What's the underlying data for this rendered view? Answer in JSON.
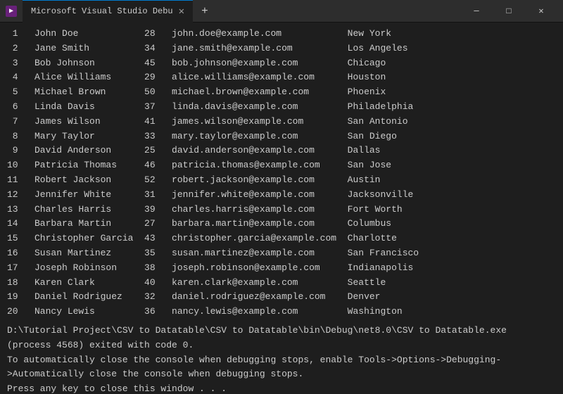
{
  "titlebar": {
    "icon_label": "VS",
    "tab_label": "Microsoft Visual Studio Debu",
    "close_symbol": "✕",
    "add_symbol": "+",
    "minimize_symbol": "─",
    "maximize_symbol": "□",
    "window_close_symbol": "✕"
  },
  "rows": [
    {
      "num": "1",
      "name": "John Doe",
      "age": "28",
      "email": "john.doe@example.com",
      "city": "New York"
    },
    {
      "num": "2",
      "name": "Jane Smith",
      "age": "34",
      "email": "jane.smith@example.com",
      "city": "Los Angeles"
    },
    {
      "num": "3",
      "name": "Bob Johnson",
      "age": "45",
      "email": "bob.johnson@example.com",
      "city": "Chicago"
    },
    {
      "num": "4",
      "name": "Alice Williams",
      "age": "29",
      "email": "alice.williams@example.com",
      "city": "Houston"
    },
    {
      "num": "5",
      "name": "Michael Brown",
      "age": "50",
      "email": "michael.brown@example.com",
      "city": "Phoenix"
    },
    {
      "num": "6",
      "name": "Linda Davis",
      "age": "37",
      "email": "linda.davis@example.com",
      "city": "Philadelphia"
    },
    {
      "num": "7",
      "name": "James Wilson",
      "age": "41",
      "email": "james.wilson@example.com",
      "city": "San Antonio"
    },
    {
      "num": "8",
      "name": "Mary Taylor",
      "age": "33",
      "email": "mary.taylor@example.com",
      "city": "San Diego"
    },
    {
      "num": "9",
      "name": "David Anderson",
      "age": "25",
      "email": "david.anderson@example.com",
      "city": "Dallas"
    },
    {
      "num": "10",
      "name": "Patricia Thomas",
      "age": "46",
      "email": "patricia.thomas@example.com",
      "city": "San Jose"
    },
    {
      "num": "11",
      "name": "Robert Jackson",
      "age": "52",
      "email": "robert.jackson@example.com",
      "city": "Austin"
    },
    {
      "num": "12",
      "name": "Jennifer White",
      "age": "31",
      "email": "jennifer.white@example.com",
      "city": "Jacksonville"
    },
    {
      "num": "13",
      "name": "Charles Harris",
      "age": "39",
      "email": "charles.harris@example.com",
      "city": "Fort Worth"
    },
    {
      "num": "14",
      "name": "Barbara Martin",
      "age": "27",
      "email": "barbara.martin@example.com",
      "city": "Columbus"
    },
    {
      "num": "15",
      "name": "Christopher Garcia",
      "age": "43",
      "email": "christopher.garcia@example.com",
      "city": "Charlotte"
    },
    {
      "num": "16",
      "name": "Susan Martinez",
      "age": "35",
      "email": "susan.martinez@example.com",
      "city": "San Francisco"
    },
    {
      "num": "17",
      "name": "Joseph Robinson",
      "age": "38",
      "email": "joseph.robinson@example.com",
      "city": "Indianapolis"
    },
    {
      "num": "18",
      "name": "Karen Clark",
      "age": "40",
      "email": "karen.clark@example.com",
      "city": "Seattle"
    },
    {
      "num": "19",
      "name": "Daniel Rodriguez",
      "age": "32",
      "email": "daniel.rodriguez@example.com",
      "city": "Denver"
    },
    {
      "num": "20",
      "name": "Nancy Lewis",
      "age": "36",
      "email": "nancy.lewis@example.com",
      "city": "Washington"
    }
  ],
  "status": {
    "line1": "D:\\Tutorial Project\\CSV to Datatable\\CSV to Datatable\\bin\\Debug\\net8.0\\CSV to Datatable.exe (process 4568) exited with code 0.",
    "line2": "To automatically close the console when debugging stops, enable Tools->Options->Debugging->Automatically close the console when debugging stops.",
    "line3": "Press any key to close this window . . ."
  }
}
